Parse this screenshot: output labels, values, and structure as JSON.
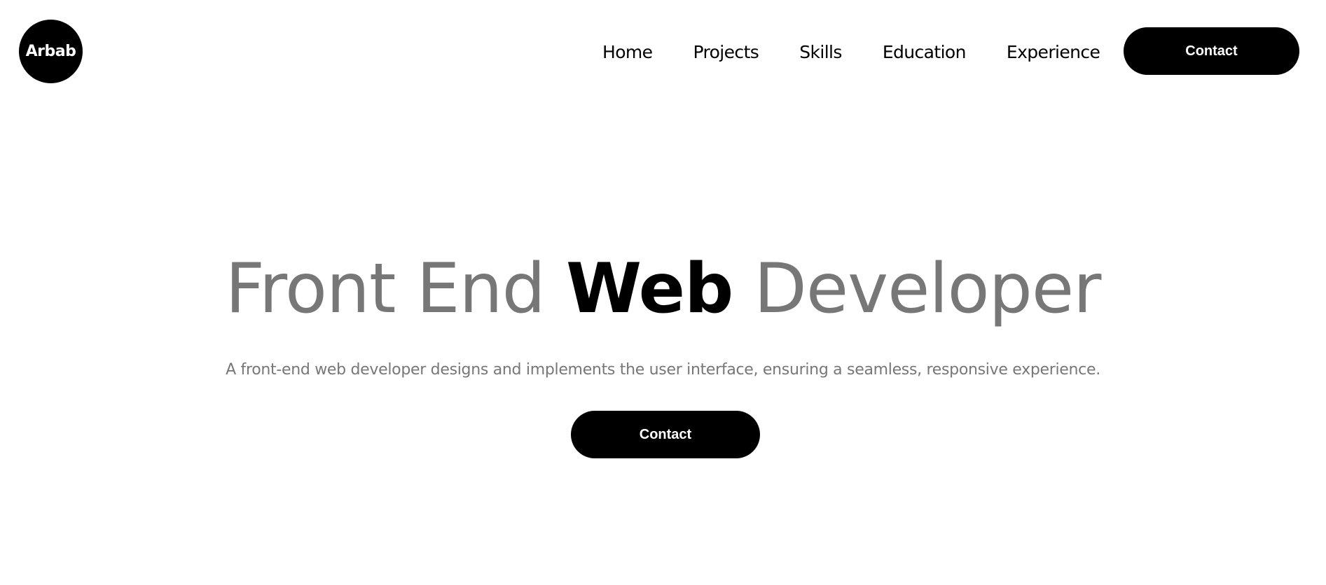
{
  "header": {
    "logo_text": "Arbab",
    "nav": [
      {
        "label": "Home"
      },
      {
        "label": "Projects"
      },
      {
        "label": "Skills"
      },
      {
        "label": "Education"
      },
      {
        "label": "Experience"
      }
    ],
    "contact_label": "Contact"
  },
  "hero": {
    "title_part1": "Front End ",
    "title_accent": "Web",
    "title_part2": " Developer",
    "subtitle": "A front-end web developer designs and implements the user interface, ensuring a seamless, responsive experience.",
    "contact_label": "Contact"
  },
  "colors": {
    "accent": "#000000",
    "muted_text": "#777777",
    "background": "#ffffff",
    "button_text": "#ffffff"
  }
}
